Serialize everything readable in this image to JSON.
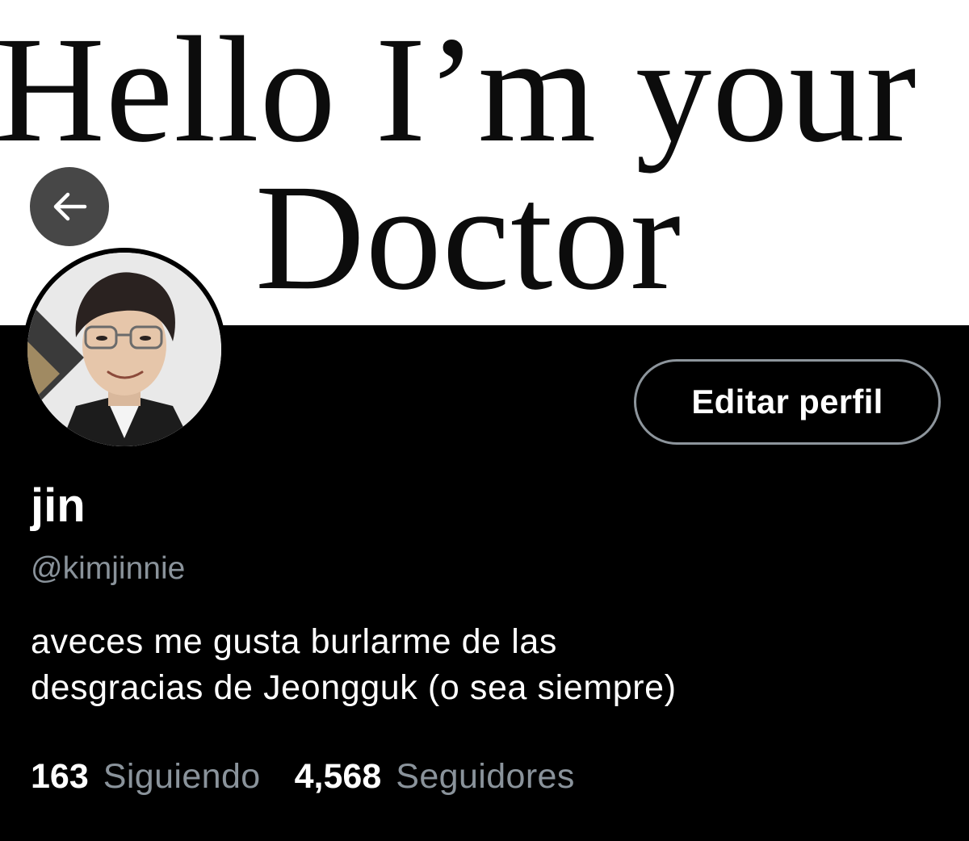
{
  "header": {
    "banner_line1": "Hello I’m your",
    "banner_line2": "Doctor"
  },
  "profile": {
    "edit_label": "Editar perfil",
    "display_name": "jin",
    "handle": "@kimjinnie",
    "bio_lines": [
      "aveces me gusta burlarme de las",
      "desgracias de Jeongguk (o sea siempre)"
    ],
    "stats": [
      {
        "count": "163",
        "label": "Siguiendo"
      },
      {
        "count": "4,568",
        "label": "Seguidores"
      }
    ]
  },
  "icons": {
    "back": "left-arrow-icon",
    "avatar": "profile-photo"
  },
  "colors": {
    "background": "#000000",
    "banner_background": "#ffffff",
    "banner_text": "#0c0c0c",
    "primary_text": "#ffffff",
    "secondary_text": "#8a939b",
    "button_border": "#8d959c",
    "back_button_bg": "#474747"
  }
}
